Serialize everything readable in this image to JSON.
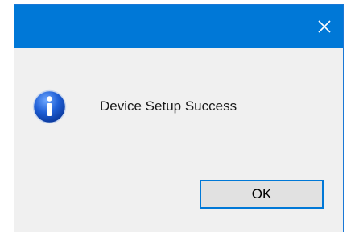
{
  "window": {
    "title": "",
    "close_icon": "close-icon",
    "accent_color": "#0078d7",
    "body_color": "#f0f0f0"
  },
  "message": {
    "icon": "info-icon",
    "text": "Device Setup Success"
  },
  "buttons": {
    "ok_label": "OK"
  }
}
